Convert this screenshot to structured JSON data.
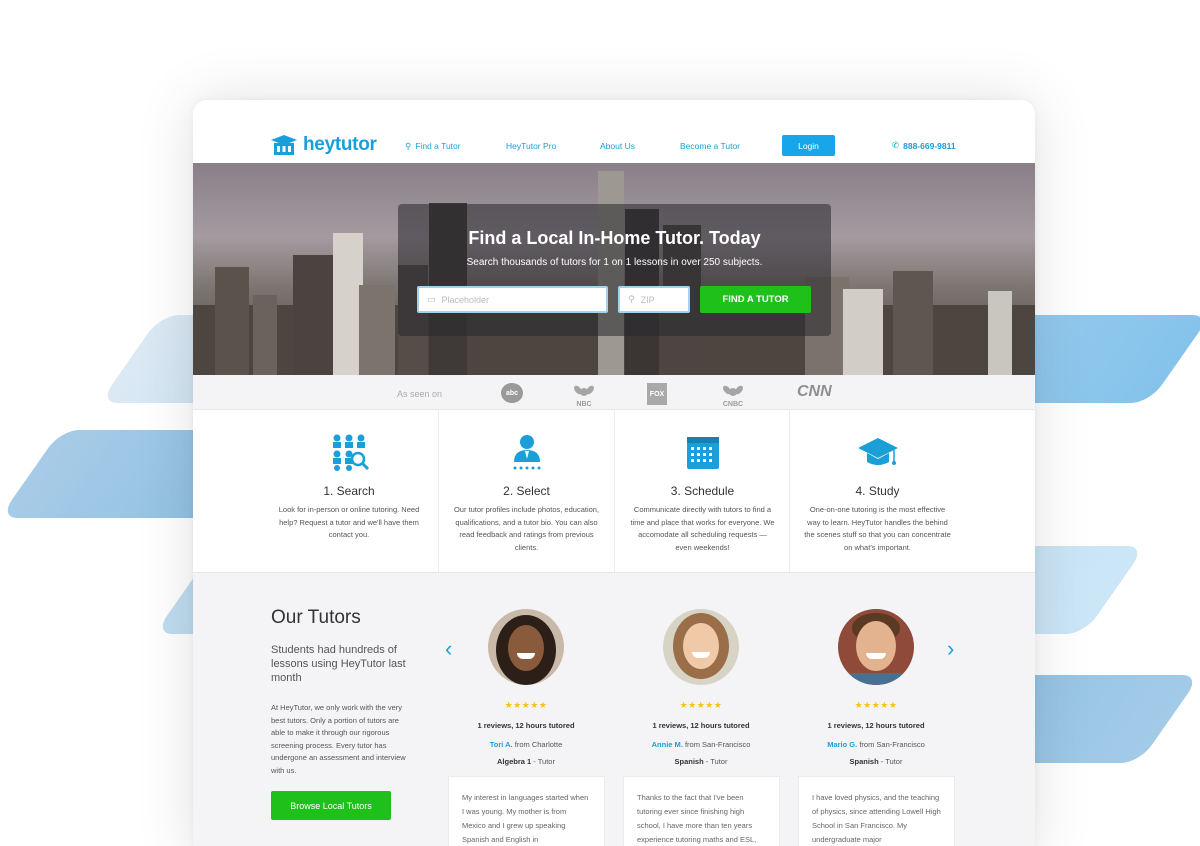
{
  "brand": {
    "name": "heytutor",
    "accent": "#1a9fd9",
    "green": "#1ec11a"
  },
  "nav": {
    "links": [
      "Find a Tutor",
      "HeyTutor Pro",
      "About Us",
      "Become a Tutor"
    ],
    "login": "Login",
    "phone": "888-669-9811"
  },
  "hero": {
    "title": "Find a Local In-Home Tutor. Today",
    "subtitle": "Search thousands of tutors for 1 on 1 lessons in over 250 subjects.",
    "search_placeholder": "Placeholder",
    "zip_placeholder": "ZIP",
    "button": "FIND A TUTOR"
  },
  "seen_on": {
    "label": "As seen on",
    "outlets": [
      "abc",
      "NBC",
      "FOX",
      "CNBC",
      "CNN"
    ]
  },
  "steps": [
    {
      "title": "1. Search",
      "icon": "people-search-icon",
      "text": "Look for in-person or online tutoring. Need help? Request a tutor and we'll have them contact you."
    },
    {
      "title": "2. Select",
      "icon": "tutor-profile-icon",
      "text": "Our tutor profiles include photos, education, qualifications, and a tutor bio. You can also read feedback and ratings from previous clients."
    },
    {
      "title": "3. Schedule",
      "icon": "calendar-icon",
      "text": "Communicate directly with tutors to find a time and place that works for everyone. We accomodate all scheduling requests — even weekends!"
    },
    {
      "title": "4. Study",
      "icon": "graduation-cap-icon",
      "text": "One-on-one tutoring is the most effective way to learn. HeyTutor handles the behind the scenes stuff so that you can concentrate on what's important."
    }
  ],
  "tutors_section": {
    "heading": "Our Tutors",
    "subheading": "Students had hundreds of lessons using HeyTutor last month",
    "body": "At HeyTutor, we only work with the very best tutors. Only a portion of tutors are able to make it through our rigorous screening process. Every tutor has undergone an assessment and interview with us.",
    "button": "Browse Local Tutors",
    "tutors": [
      {
        "stars": "★★★★★",
        "reviews": "1 reviews, 12 hours tutored",
        "name": "Tori A.",
        "from": "from Charlotte",
        "subject": "Algebra 1",
        "role": "- Tutor",
        "quote": "My interest in languages started when I was young. My mother is from Mexico and I grew up speaking Spanish and English in"
      },
      {
        "stars": "★★★★★",
        "reviews": "1 reviews, 12 hours tutored",
        "name": "Annie M.",
        "from": "from San-Francisco",
        "subject": "Spanish",
        "role": "- Tutor",
        "quote": "Thanks to the fact that I've been tutoring ever since finishing high school, I have more than ten years experience tutoring maths and ESL,"
      },
      {
        "stars": "★★★★★",
        "reviews": "1 reviews, 12 hours tutored",
        "name": "Mario G.",
        "from": "from San-Francisco",
        "subject": "Spanish",
        "role": "- Tutor",
        "quote": "I have loved physics, and the teaching of physics, since attending Lowell High School in San Francisco. My undergraduate major"
      }
    ]
  }
}
